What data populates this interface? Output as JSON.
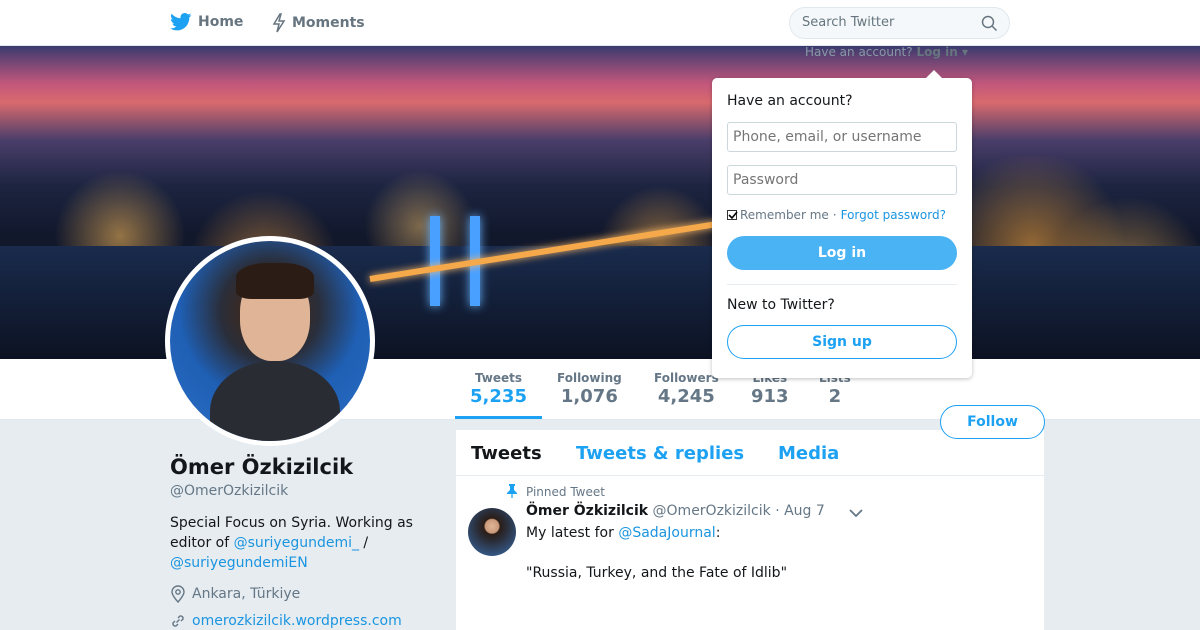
{
  "nav": {
    "home": "Home",
    "moments": "Moments",
    "search_placeholder": "Search Twitter"
  },
  "account_prompt": {
    "text": "Have an account?",
    "login": "Log in"
  },
  "login_popup": {
    "title": "Have an account?",
    "username_placeholder": "Phone, email, or username",
    "password_placeholder": "Password",
    "remember": "Remember me",
    "separator": "·",
    "forgot": "Forgot password?",
    "login_button": "Log in",
    "new_to": "New to Twitter?",
    "signup_button": "Sign up"
  },
  "stats": [
    {
      "label": "Tweets",
      "value": "5,235"
    },
    {
      "label": "Following",
      "value": "1,076"
    },
    {
      "label": "Followers",
      "value": "4,245"
    },
    {
      "label": "Likes",
      "value": "913"
    },
    {
      "label": "Lists",
      "value": "2"
    }
  ],
  "follow_button": "Follow",
  "profile": {
    "name": "Ömer Özkizilcik",
    "handle": "@OmerOzkizilcik",
    "bio_1": "Special Focus on Syria. Working as editor of ",
    "bio_link_1": "@suriyegundemi_",
    "bio_2": " / ",
    "bio_link_2": "@suriyegundemiEN",
    "location": "Ankara, Türkiye",
    "website": "omerozkizilcik.wordpress.com"
  },
  "tabs": [
    "Tweets",
    "Tweets & replies",
    "Media"
  ],
  "tweet": {
    "pinned_label": "Pinned Tweet",
    "name": "Ömer Özkizilcik",
    "handle": "@OmerOzkizilcik",
    "date": "· Aug 7",
    "text_prefix": "My latest for ",
    "mention": "@SadaJournal",
    "text_suffix": ":",
    "quote": "\"Russia, Turkey, and the Fate of Idlib\""
  },
  "colors": {
    "accent": "#1da1f2",
    "link": "#1b95e0",
    "muted": "#657786"
  }
}
